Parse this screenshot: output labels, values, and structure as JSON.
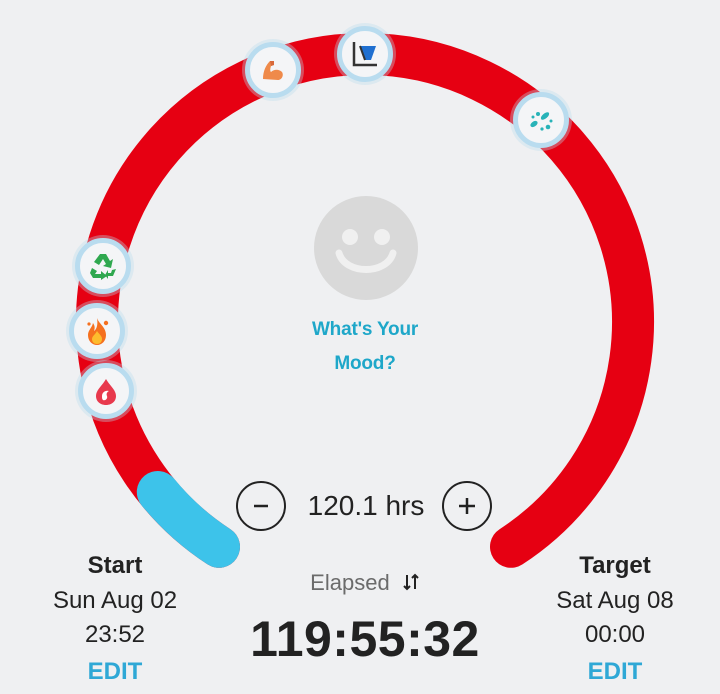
{
  "progress": {
    "elapsed_fraction": 0.06,
    "colors": {
      "track": "#e60012",
      "elapsed": "#3dc3ea",
      "badge_ring": "#b9dcef"
    }
  },
  "stage_badges": [
    {
      "name": "muscle-icon"
    },
    {
      "name": "autophagy-chart-icon"
    },
    {
      "name": "bacteria-icon"
    },
    {
      "name": "recycle-icon"
    },
    {
      "name": "fire-icon"
    },
    {
      "name": "ketone-drop-icon"
    }
  ],
  "mood": {
    "icon": "smiley-face-icon",
    "line1": "What's Your",
    "line2": "Mood?"
  },
  "goal": {
    "value": "120.1 hrs",
    "minus_icon": "minus-icon",
    "plus_icon": "plus-icon"
  },
  "start": {
    "label": "Start",
    "date": "Sun Aug 02",
    "time": "23:52",
    "edit": "EDIT"
  },
  "target": {
    "label": "Target",
    "date": "Sat Aug 08",
    "time": "00:00",
    "edit": "EDIT"
  },
  "elapsed": {
    "label": "Elapsed",
    "value": "119:55:32",
    "toggle_icon": "swap-arrows-icon"
  }
}
